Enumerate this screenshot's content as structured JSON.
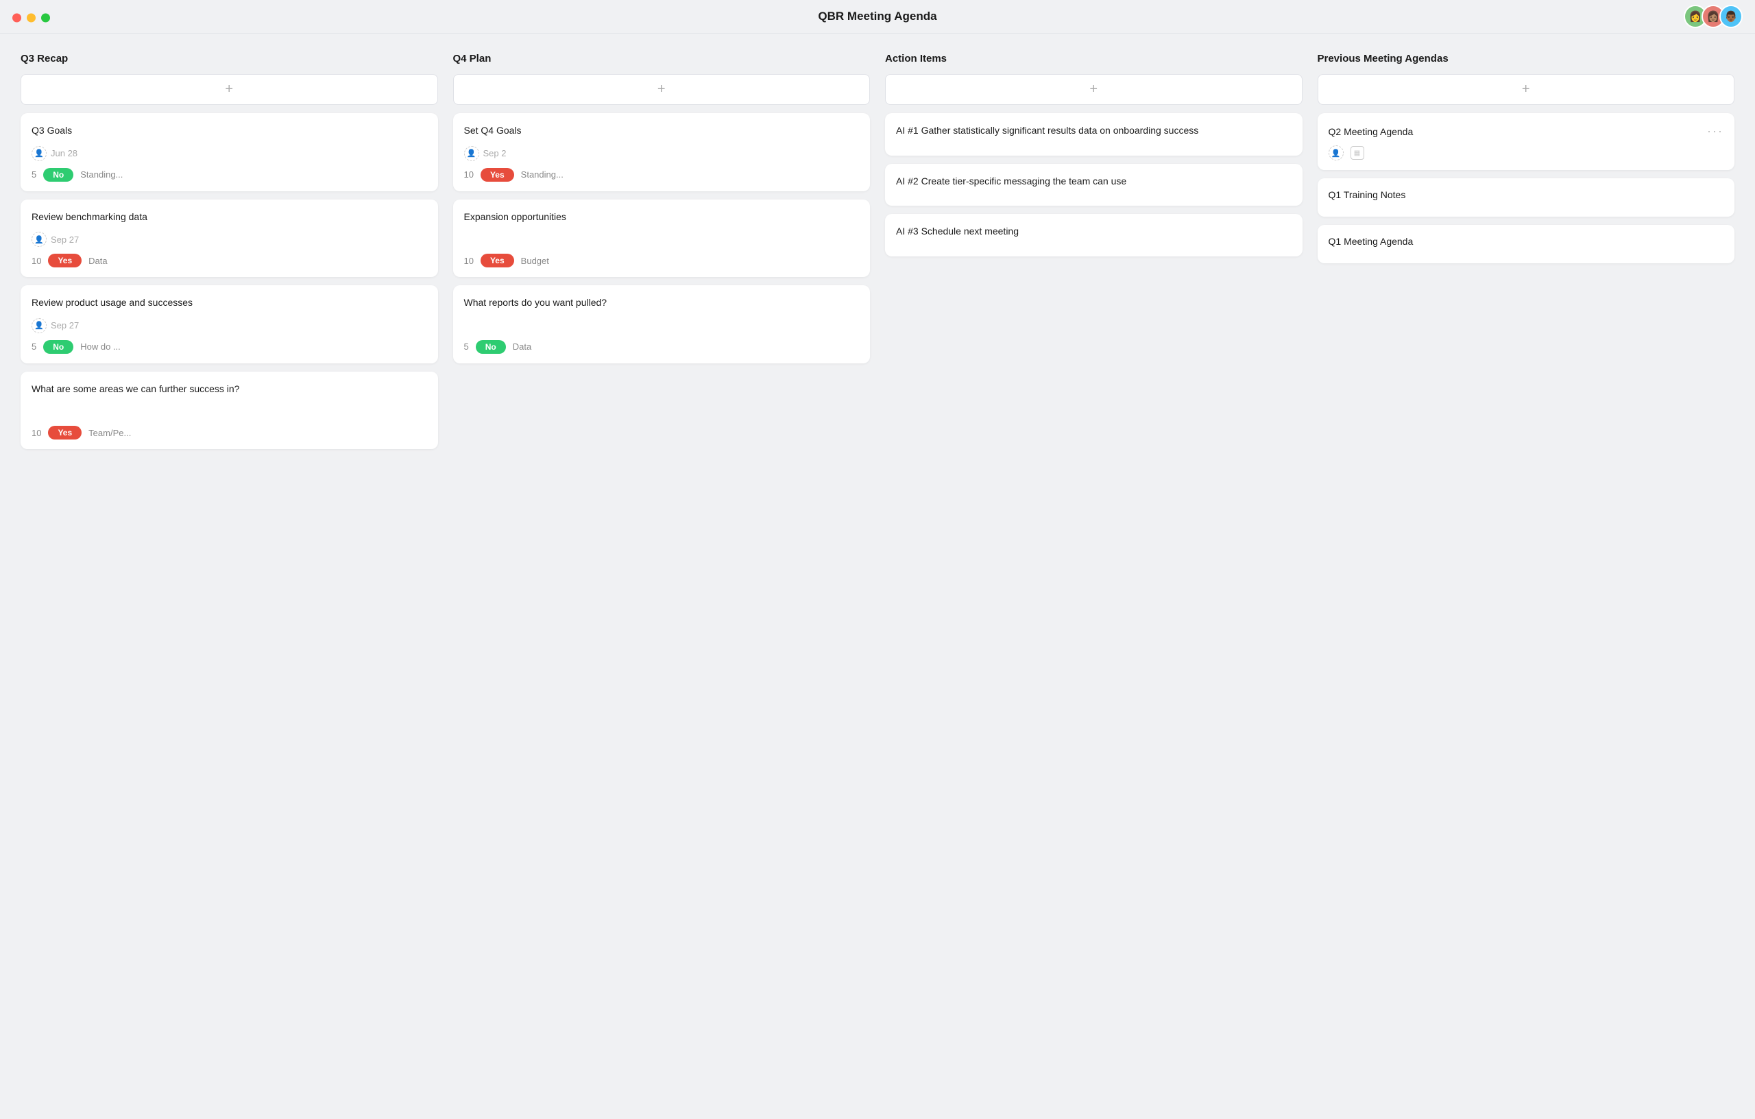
{
  "titleBar": {
    "title": "QBR Meeting Agenda",
    "avatars": [
      {
        "id": "av1",
        "emoji": "👩",
        "color": "#5b9bd5"
      },
      {
        "id": "av2",
        "emoji": "👩🏽",
        "color": "#e67c73"
      },
      {
        "id": "av3",
        "emoji": "👨🏾",
        "color": "#4fc3f7"
      }
    ]
  },
  "columns": [
    {
      "id": "q3recap",
      "header": "Q3 Recap",
      "addLabel": "+",
      "cards": [
        {
          "id": "q3goals",
          "title": "Q3 Goals",
          "date": "Jun 28",
          "number": "5",
          "badge": "No",
          "badgeType": "no",
          "label": "Standing..."
        },
        {
          "id": "benchmarking",
          "title": "Review benchmarking data",
          "date": "Sep 27",
          "number": "10",
          "badge": "Yes",
          "badgeType": "yes",
          "label": "Data"
        },
        {
          "id": "product-usage",
          "title": "Review product usage and successes",
          "date": "Sep 27",
          "number": "5",
          "badge": "No",
          "badgeType": "no",
          "label": "How do ..."
        },
        {
          "id": "further-success",
          "title": "What are some areas we can further success in?",
          "date": null,
          "number": "10",
          "badge": "Yes",
          "badgeType": "yes",
          "label": "Team/Pe..."
        }
      ]
    },
    {
      "id": "q4plan",
      "header": "Q4 Plan",
      "addLabel": "+",
      "cards": [
        {
          "id": "set-q4goals",
          "title": "Set Q4 Goals",
          "date": "Sep 2",
          "number": "10",
          "badge": "Yes",
          "badgeType": "yes",
          "label": "Standing..."
        },
        {
          "id": "expansion",
          "title": "Expansion opportunities",
          "date": null,
          "number": "10",
          "badge": "Yes",
          "badgeType": "yes",
          "label": "Budget"
        },
        {
          "id": "reports",
          "title": "What reports do you want pulled?",
          "date": null,
          "number": "5",
          "badge": "No",
          "badgeType": "no",
          "label": "Data"
        }
      ]
    },
    {
      "id": "action-items",
      "header": "Action Items",
      "addLabel": "+",
      "cards": [
        {
          "id": "ai1",
          "title": "AI #1 Gather statistically significant results data on onboarding success",
          "date": null,
          "number": null,
          "badge": null,
          "badgeType": null,
          "label": null
        },
        {
          "id": "ai2",
          "title": "AI #2 Create tier-specific messaging the team can use",
          "date": null,
          "number": null,
          "badge": null,
          "badgeType": null,
          "label": null
        },
        {
          "id": "ai3",
          "title": "AI #3 Schedule next meeting",
          "date": null,
          "number": null,
          "badge": null,
          "badgeType": null,
          "label": null
        }
      ]
    },
    {
      "id": "previous-agendas",
      "header": "Previous Meeting Agendas",
      "addLabel": "+",
      "cards": [
        {
          "id": "q2agenda",
          "title": "Q2 Meeting Agenda",
          "showIcons": true,
          "hasDots": true
        },
        {
          "id": "q1training",
          "title": "Q1 Training Notes",
          "showIcons": false,
          "hasDots": false
        },
        {
          "id": "q1agenda",
          "title": "Q1 Meeting Agenda",
          "showIcons": false,
          "hasDots": false
        }
      ]
    }
  ]
}
